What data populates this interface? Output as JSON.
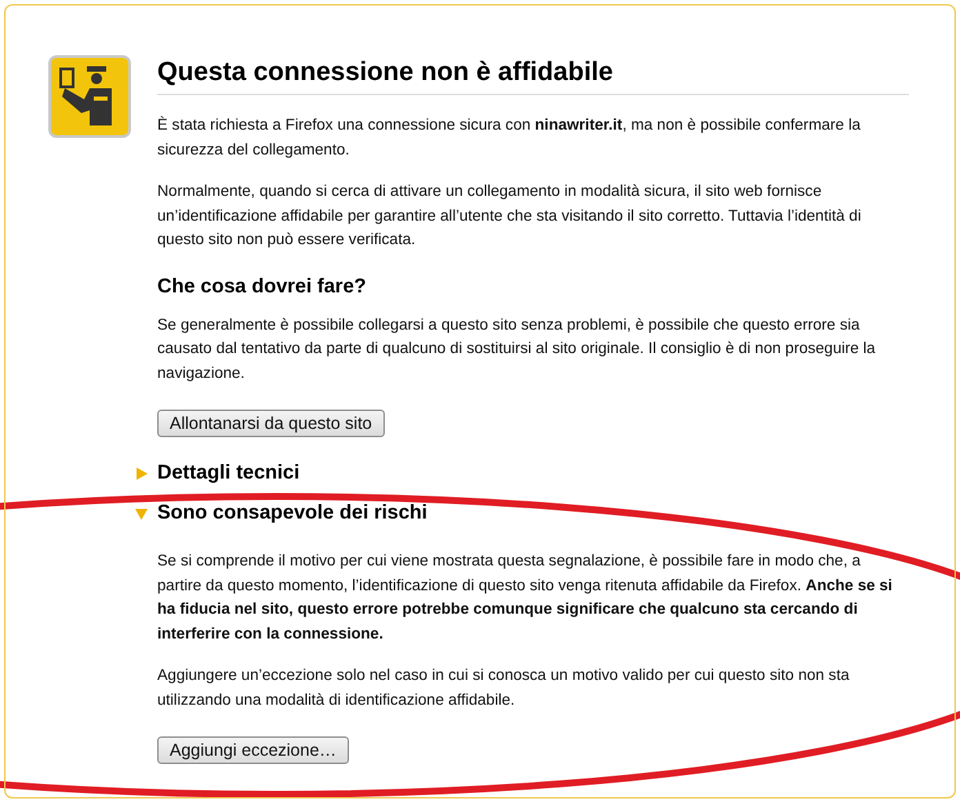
{
  "title": "Questa connessione non è affidabile",
  "intro": [
    "È stata richiesta a Firefox una connessione sicura con **ninawriter.it**, ma non è possibile confermare la sicurezza del collegamento.",
    "Normalmente, quando si cerca di attivare un collegamento in modalità sicura, il sito web fornisce un’identificazione affidabile per garantire all’utente che sta visitando il sito corretto. Tuttavia l’identità di questo sito non può essere verificata."
  ],
  "what_to_do": {
    "heading": "Che cosa dovrei fare?",
    "text": "Se generalmente è possibile collegarsi a questo sito senza problemi, è possibile che questo errore sia causato dal tentativo da parte di qualcuno di sostituirsi al sito originale. Il consiglio è di non proseguire la navigazione.",
    "button": "Allontanarsi da questo sito"
  },
  "sections": [
    {
      "title": "Dettagli tecnici",
      "expanded": false
    },
    {
      "title": "Sono consapevole dei rischi",
      "expanded": true,
      "paragraphs": [
        "Se si comprende il motivo per cui viene mostrata questa segnalazione, è possibile fare in modo che, a partire da questo momento, l’identificazione di questo sito venga ritenuta affidabile da Firefox. **Anche se si ha fiducia nel sito, questo errore potrebbe comunque significare che qualcuno sta cercando di interferire con la connessione.**",
        "Aggiungere un’eccezione solo nel caso in cui si conosca un motivo valido per cui questo sito non sta utilizzando una modalità di identificazione affidabile."
      ],
      "button": "Aggiungi eccezione…"
    }
  ],
  "annotation": {
    "kind": "ellipse"
  }
}
